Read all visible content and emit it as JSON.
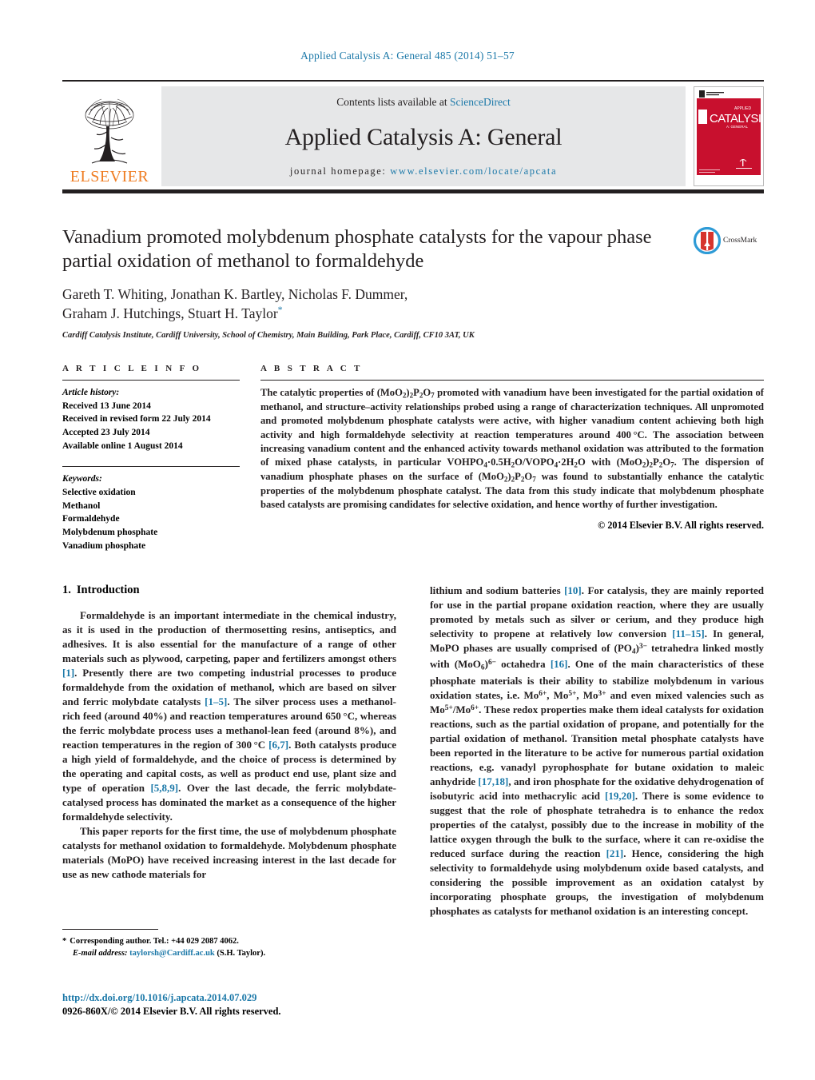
{
  "running_head": "Applied Catalysis A: General 485 (2014) 51–57",
  "masthead": {
    "publisher_name": "ELSEVIER",
    "contents_prefix": "Contents lists available at ",
    "contents_link": "ScienceDirect",
    "journal_name": "Applied Catalysis A: General",
    "homepage_prefix": "journal homepage: ",
    "homepage_url": "www.elsevier.com/locate/apcata",
    "cover_title": "CATALYSIS"
  },
  "article": {
    "title": "Vanadium promoted molybdenum phosphate catalysts for the vapour phase partial oxidation of methanol to formaldehyde",
    "crossmark_label": "CrossMark",
    "authors_line1": "Gareth T. Whiting, Jonathan K. Bartley, Nicholas F. Dummer,",
    "authors_line2": "Graham J. Hutchings, Stuart H. Taylor",
    "corresponding_marker": "*",
    "affiliation": "Cardiff Catalysis Institute, Cardiff University, School of Chemistry, Main Building, Park Place, Cardiff, CF10 3AT, UK"
  },
  "article_info": {
    "label": "A R T I C L E   I N F O",
    "history_title": "Article history:",
    "history": [
      "Received 13 June 2014",
      "Received in revised form 22 July 2014",
      "Accepted 23 July 2014",
      "Available online 1 August 2014"
    ],
    "keywords_title": "Keywords:",
    "keywords": [
      "Selective oxidation",
      "Methanol",
      "Formaldehyde",
      "Molybdenum phosphate",
      "Vanadium phosphate"
    ]
  },
  "abstract": {
    "label": "A B S T R A C T",
    "copyright": "© 2014 Elsevier B.V. All rights reserved."
  },
  "introduction": {
    "heading_number": "1.",
    "heading_title": "Introduction"
  },
  "footnote": {
    "corresponding": "Corresponding author. Tel.: +44 029 2087 4062.",
    "email_label": "E-mail address:",
    "email": "taylorsh@Cardiff.ac.uk",
    "email_owner": "(S.H. Taylor).",
    "star": "*"
  },
  "footer": {
    "doi": "http://dx.doi.org/10.1016/j.apcata.2014.07.029",
    "issn": "0926-860X/© 2014 Elsevier B.V. All rights reserved."
  },
  "colors": {
    "link": "#1b78a8",
    "elsevier_orange": "#ef7d23",
    "cover_red": "#c8102e",
    "masthead_gray": "#e6e7e8"
  }
}
